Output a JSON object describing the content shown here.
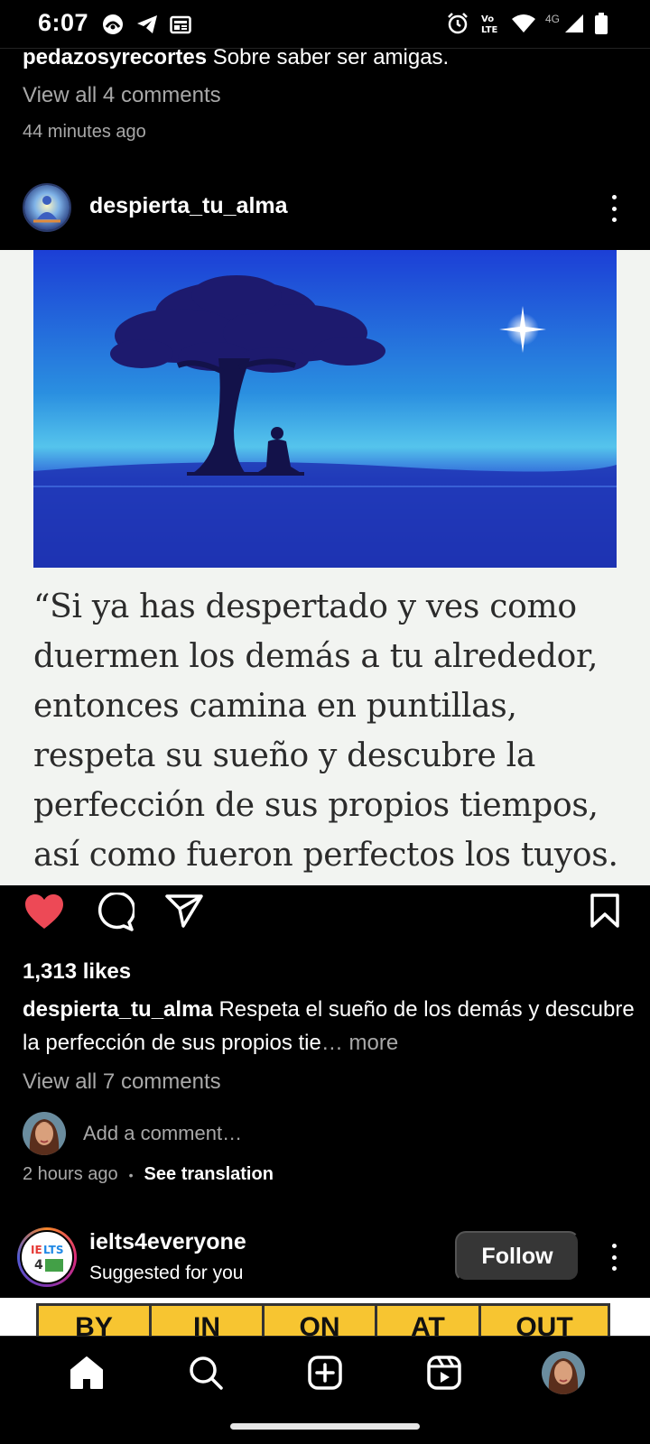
{
  "status_bar": {
    "time": "6:07",
    "network": "4G",
    "icons": [
      "ring-app-icon",
      "telegram-icon",
      "news-icon",
      "alarm-icon",
      "volte-icon",
      "wifi-icon",
      "signal-icon",
      "battery-icon"
    ]
  },
  "previous_post": {
    "username": "pedazosyrecortes",
    "caption": "Sobre saber ser amigas.",
    "view_comments": "View all 4 comments",
    "time": "44 minutes ago"
  },
  "post": {
    "username": "despierta_tu_alma",
    "image_quote": "“Si ya has despertado y ves como\nduermen los demás a tu alrededor,\nentonces camina en puntillas,\nrespeta su sueño y descubre la\nperfección de sus propios tiempos,\nasí como fueron perfectos los tuyos.",
    "liked": true,
    "likes": "1,313 likes",
    "caption_username": "despierta_tu_alma",
    "caption_text": "Respeta el sueño de los demás y descubre la perfección de sus propios tie",
    "caption_more": "… more",
    "view_comments": "View all 7 comments",
    "add_comment_placeholder": "Add a comment…",
    "time": "2 hours ago",
    "dot": "•",
    "see_translation": "See translation"
  },
  "suggested_post": {
    "username": "ielts4everyone",
    "subtitle": "Suggested for you",
    "follow_label": "Follow",
    "image_cells": [
      "BY",
      "IN",
      "ON",
      "AT",
      "OUT"
    ]
  },
  "colors": {
    "background": "#000000",
    "like_red": "#ed4956",
    "secondary_text": "#a8a8a8",
    "follow_button": "#363636"
  },
  "nav": [
    "home-icon",
    "search-icon",
    "create-icon",
    "reels-icon",
    "profile-avatar"
  ]
}
